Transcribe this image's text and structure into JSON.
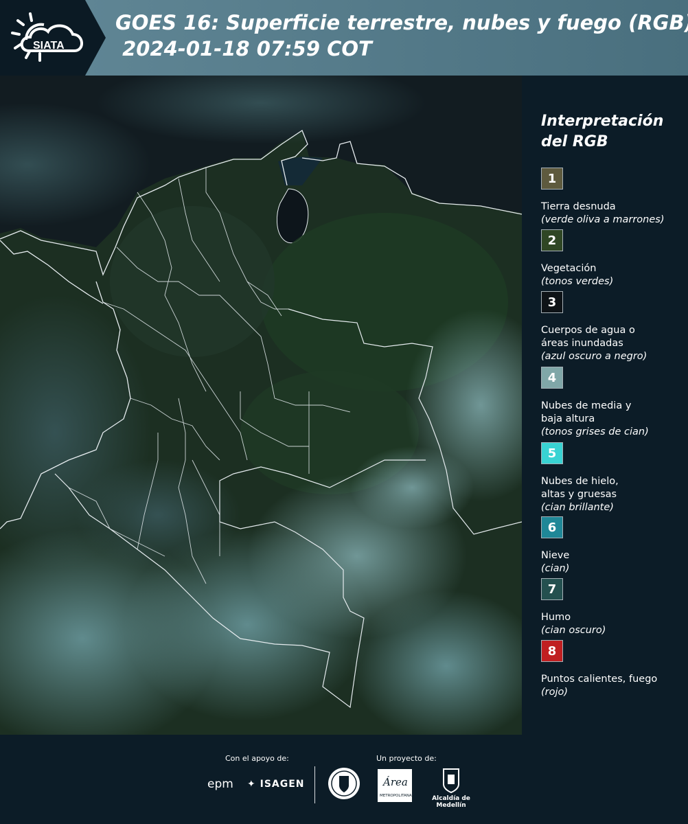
{
  "header": {
    "logo_text": "SIATA",
    "title_line1": "GOES 16: Superficie terrestre, nubes y fuego (RGB)",
    "title_line2": " 2024-01-18 07:59 COT"
  },
  "map": {
    "region": "Colombia",
    "colors": {
      "ocean": "#0f181d",
      "land_dark": "#1d3322",
      "cloud_cyan": "#5f8d94",
      "border": "#e6ecef"
    }
  },
  "legend": {
    "title": "Interpretación del RGB",
    "items": [
      {
        "num": "1",
        "color": "#5e5a3e",
        "label": "Tierra desnuda",
        "sub": "(verde oliva a marrones)"
      },
      {
        "num": "2",
        "color": "#2f4624",
        "label": "Vegetación",
        "sub": "(tonos verdes)"
      },
      {
        "num": "3",
        "color": "#0e1317",
        "label": "Cuerpos de agua o\náreas inundadas",
        "sub": "(azul oscuro a negro)"
      },
      {
        "num": "4",
        "color": "#80a7a8",
        "label": "Nubes de media y\nbaja altura",
        "sub": "(tonos grises de cian)"
      },
      {
        "num": "5",
        "color": "#39d3d3",
        "label": "Nubes de hielo,\naltas y gruesas",
        "sub": "(cian brillante)"
      },
      {
        "num": "6",
        "color": "#1f8797",
        "label": "Nieve",
        "sub": "(cian)"
      },
      {
        "num": "7",
        "color": "#24504f",
        "label": "Humo",
        "sub": "(cian oscuro)"
      },
      {
        "num": "8",
        "color": "#c01f21",
        "label": "Puntos calientes, fuego",
        "sub": "(rojo)"
      }
    ]
  },
  "footer": {
    "support_label": "Con el apoyo de:",
    "project_label": "Un proyecto de:",
    "sponsor_1": "epm",
    "sponsor_2": "ISAGEN",
    "project_1": "Universidad / Medellín seal",
    "project_2_logo": "Área",
    "project_2_sub": "METROPOLITANA",
    "project_3": "Alcaldía de Medellín"
  }
}
